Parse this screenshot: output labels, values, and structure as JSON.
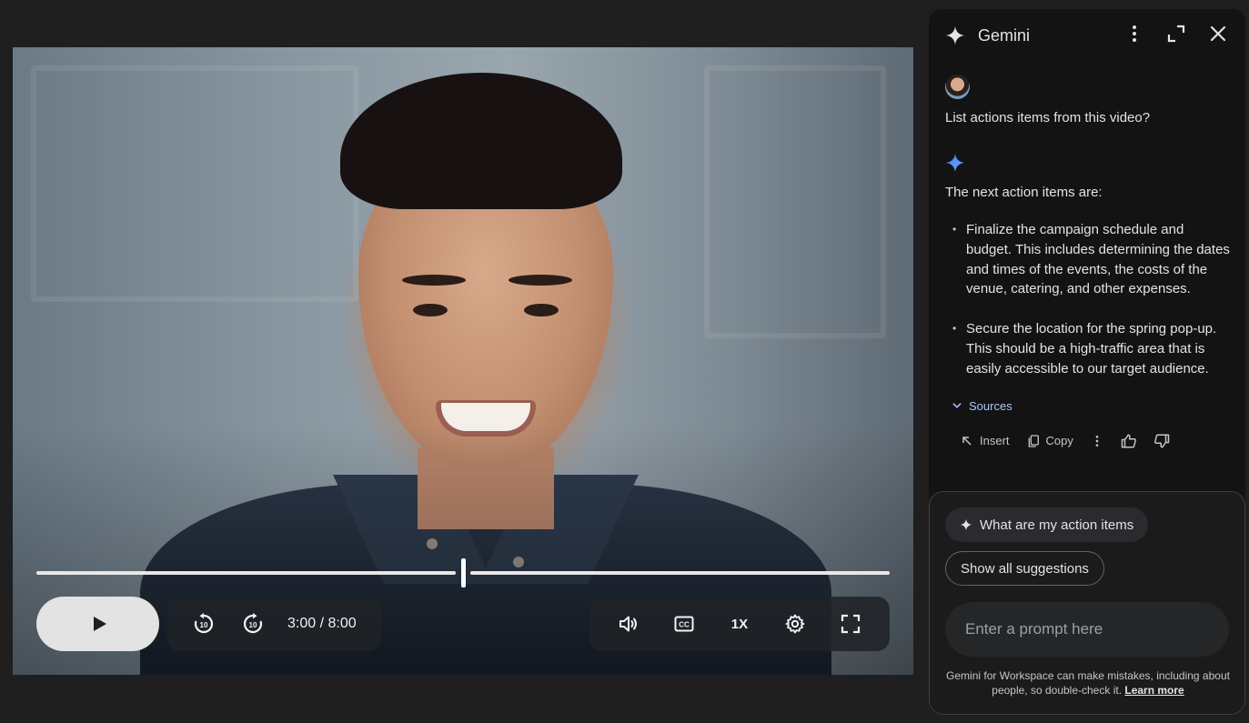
{
  "player": {
    "current_time": "3:00",
    "duration": "8:00",
    "time_display": "3:00 / 8:00",
    "progress_fraction": 0.5,
    "speed_label": "1X",
    "icons": {
      "play": "play-icon",
      "rewind": "replay-10-icon",
      "forward": "forward-10-icon",
      "volume": "volume-icon",
      "captions": "closed-captions-icon",
      "settings": "gear-icon",
      "fullscreen": "fullscreen-icon"
    }
  },
  "panel": {
    "title": "Gemini",
    "icons": {
      "logo": "sparkle-icon",
      "menu": "more-vert-icon",
      "expand": "expand-icon",
      "close": "close-icon"
    },
    "user_message": "List actions items from this video?",
    "answer": {
      "intro": "The next action items are:",
      "bullets": [
        "Finalize the campaign schedule and budget. This includes determining the dates and times of the events, the costs of the venue, catering, and other expenses.",
        "Secure the location for the spring pop-up. This should be a high-traffic area that is easily accessible to our target audience."
      ],
      "sources_label": "Sources",
      "insert_label": "Insert",
      "copy_label": "Copy"
    },
    "suggestions": {
      "primary_chip": "What are my action items",
      "show_all": "Show all suggestions"
    },
    "prompt": {
      "placeholder": "Enter a prompt here",
      "value": ""
    },
    "disclaimer": {
      "text": "Gemini for Workspace can make mistakes, including about people, so double-check it.",
      "link": "Learn more"
    }
  },
  "colors": {
    "page_bg": "#1f1f1f",
    "panel_bg": "#131314",
    "accent_blue": "#a8c7fa",
    "gemini_blue": "#4285f4"
  }
}
